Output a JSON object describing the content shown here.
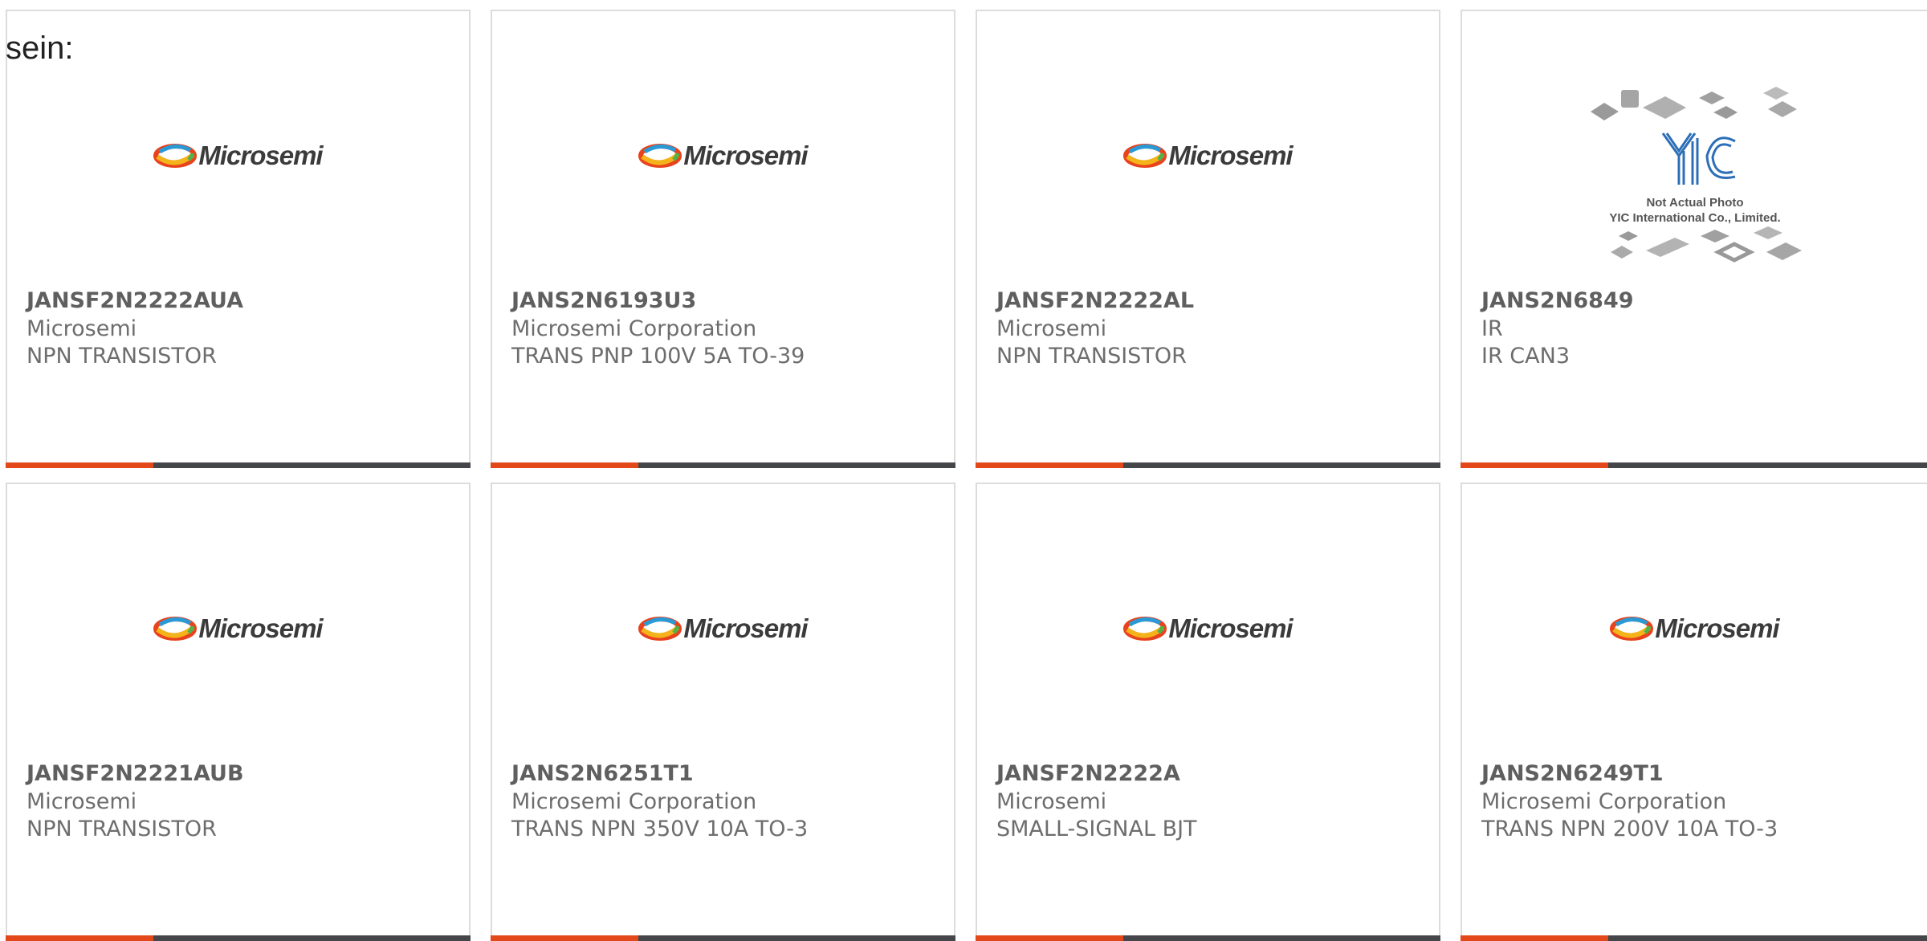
{
  "page": {
    "fragment_text": "sein:"
  },
  "colors": {
    "accent_orange": "#e2481a",
    "bar_dark": "#444649",
    "card_border": "#dcdcdc",
    "text_gray": "#6d6d6d"
  },
  "products": [
    {
      "part": "JANSF2N2222AUA",
      "manufacturer": "Microsemi",
      "description": "NPN TRANSISTOR",
      "logo": "microsemi-logo"
    },
    {
      "part": "JANS2N6193U3",
      "manufacturer": "Microsemi Corporation",
      "description": "TRANS PNP 100V 5A TO-39",
      "logo": "microsemi-logo"
    },
    {
      "part": "JANSF2N2222AL",
      "manufacturer": "Microsemi",
      "description": "NPN TRANSISTOR",
      "logo": "microsemi-logo"
    },
    {
      "part": "JANS2N6849",
      "manufacturer": "IR",
      "description": "IR CAN3",
      "logo": "yic-not-actual-photo"
    },
    {
      "part": "JANSF2N2221AUB",
      "manufacturer": "Microsemi",
      "description": "NPN TRANSISTOR",
      "logo": "microsemi-logo"
    },
    {
      "part": "JANS2N6251T1",
      "manufacturer": "Microsemi Corporation",
      "description": "TRANS NPN 350V 10A TO-3",
      "logo": "microsemi-logo"
    },
    {
      "part": "JANSF2N2222A",
      "manufacturer": "Microsemi",
      "description": "SMALL-SIGNAL BJT",
      "logo": "microsemi-logo"
    },
    {
      "part": "JANS2N6249T1",
      "manufacturer": "Microsemi Corporation",
      "description": "TRANS NPN 200V 10A TO-3",
      "logo": "microsemi-logo"
    }
  ],
  "logos": {
    "microsemi_word": "Microsemi",
    "yic_line1": "Not Actual Photo",
    "yic_line2": "YIC International Co., Limited.",
    "yic_mark": "YIC"
  }
}
